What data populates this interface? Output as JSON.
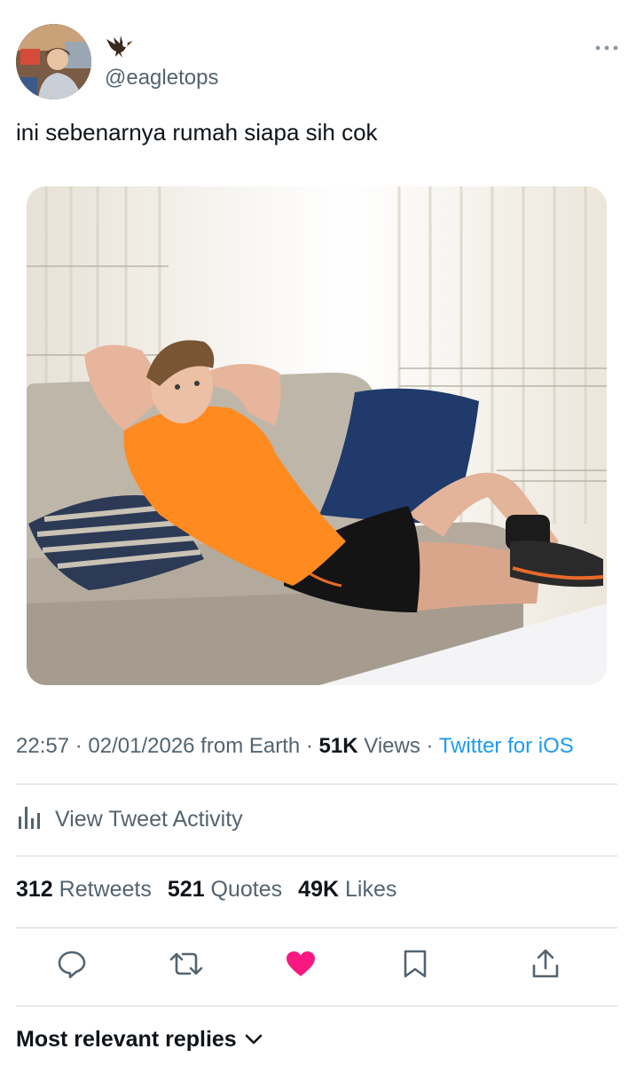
{
  "author": {
    "handle": "@eagletops",
    "avatar_icon": "profile-photo",
    "display_name_icon": "eagle-emoji"
  },
  "tweet": {
    "text": "ini sebenarnya rumah siapa sih cok",
    "photo": "man-in-orange-shirt-lounging-on-sofa"
  },
  "meta": {
    "time": "22:57",
    "sep1": " · ",
    "date": "02/01/2026",
    "from": " from Earth",
    "sep2": " · ",
    "views_count": "51K",
    "views_label": " Views",
    "sep3": " · ",
    "client": "Twitter for iOS"
  },
  "activity": {
    "label": "View Tweet Activity",
    "icon": "bar-chart-icon"
  },
  "stats": {
    "retweets_count": "312",
    "retweets_label": " Retweets",
    "quotes_count": "521",
    "quotes_label": " Quotes",
    "likes_count": "49K",
    "likes_label": " Likes"
  },
  "actions": [
    {
      "name": "reply",
      "icon": "speech-bubble-icon"
    },
    {
      "name": "retweet",
      "icon": "retweet-icon"
    },
    {
      "name": "like",
      "icon": "heart-icon",
      "active": true
    },
    {
      "name": "bookmark",
      "icon": "bookmark-icon"
    },
    {
      "name": "share",
      "icon": "share-icon"
    }
  ],
  "replies": {
    "label": "Most relevant replies"
  },
  "colors": {
    "text": "#0f1419",
    "secondary": "#536471",
    "link": "#1d9bf0",
    "like_active": "#f91880",
    "divider": "#cfd9de"
  }
}
